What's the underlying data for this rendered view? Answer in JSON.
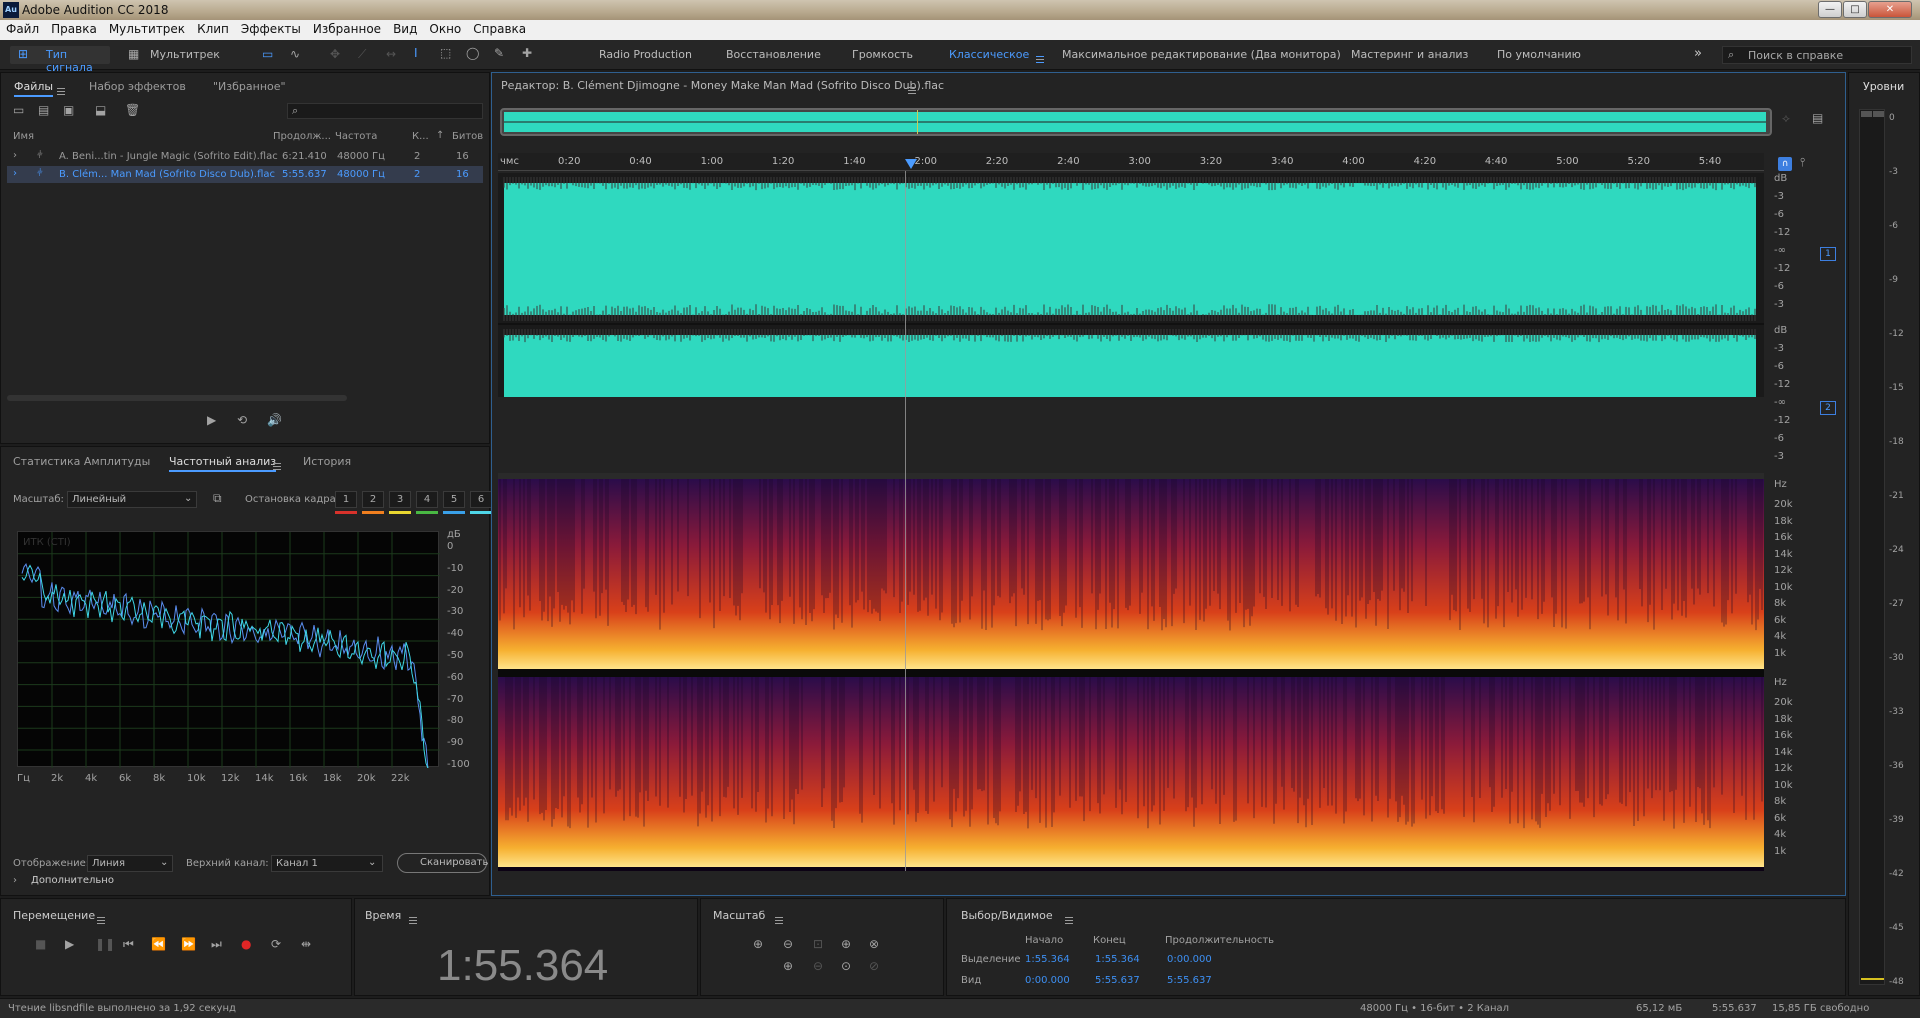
{
  "app": {
    "title": "Adobe Audition CC 2018",
    "logo_text": "Au"
  },
  "window_controls": [
    "—",
    "□",
    "✕"
  ],
  "menu": [
    "Файл",
    "Правка",
    "Мультитрек",
    "Клип",
    "Эффекты",
    "Избранное",
    "Вид",
    "Окно",
    "Справка"
  ],
  "toolbar": {
    "waveform_label": "Тип сигнала",
    "multitrack_label": "Мультитрек",
    "workspaces": [
      "Radio Production",
      "Восстановление",
      "Громкость",
      "Классическое",
      "Максимальное редактирование (Два монитора)",
      "Мастеринг и анализ",
      "По умолчанию"
    ],
    "active_workspace": "Классическое",
    "search_placeholder": "Поиск в справке"
  },
  "files_panel": {
    "tabs": [
      "Файлы",
      "Набор эффектов",
      "\"Избранное\""
    ],
    "columns": [
      "Имя",
      "Продолж...",
      "Частота",
      "К...",
      "Битов"
    ],
    "rows": [
      {
        "name": "A. Beni...tin - Jungle Magic (Sofrito Edit).flac",
        "duration": "6:21.410",
        "rate": "48000 Гц",
        "channels": "2",
        "bits": "16",
        "selected": false
      },
      {
        "name": "B. Clém... Man Mad (Sofrito Disco Dub).flac",
        "duration": "5:55.637",
        "rate": "48000 Гц",
        "channels": "2",
        "bits": "16",
        "selected": true
      }
    ]
  },
  "analysis_panel": {
    "tabs": [
      "Статистика Амплитуды",
      "Частотный анализ",
      "История"
    ],
    "scale_label": "Масштаб:",
    "scale_value": "Линейный",
    "freeze_label": "Остановка кадра:",
    "freeze_buttons": [
      "1",
      "2",
      "3",
      "4",
      "5",
      "6"
    ],
    "freeze_colors": [
      "#d8322b",
      "#f07f1f",
      "#e8d630",
      "#49b843",
      "#3aa0e8",
      "#4fd6e8"
    ],
    "graph_label": "ИТК (СТІ)",
    "db_unit": "дБ",
    "db_ticks": [
      "0",
      "-10",
      "-20",
      "-30",
      "-40",
      "-50",
      "-60",
      "-70",
      "-80",
      "-90",
      "-100"
    ],
    "freq_ticks": [
      "Гц",
      "2k",
      "4k",
      "6k",
      "8k",
      "10k",
      "12k",
      "14k",
      "16k",
      "18k",
      "20k",
      "22k"
    ],
    "display_label": "Отображение:",
    "display_value": "Линия",
    "channel_label": "Верхний канал:",
    "channel_value": "Канал 1",
    "scan_label": "Сканировать",
    "advanced_label": "Дополнительно"
  },
  "editor": {
    "title": "Редактор: B. Clément Djimogne - Money Make Man Mad (Sofrito Disco Dub).flac",
    "time_ruler": [
      "чмс",
      "0:20",
      "0:40",
      "1:00",
      "1:20",
      "1:40",
      "2:00",
      "2:20",
      "2:40",
      "3:00",
      "3:20",
      "3:40",
      "4:00",
      "4:20",
      "4:40",
      "5:00",
      "5:20",
      "5:40"
    ],
    "db_scale": [
      "dB",
      "-3",
      "-6",
      "-12",
      "-∞",
      "-12",
      "-6",
      "-3"
    ],
    "channel_badges": [
      "1",
      "2"
    ],
    "hz_scale": [
      "Hz",
      "20k",
      "18k",
      "16k",
      "14k",
      "12k",
      "10k",
      "8k",
      "6k",
      "4k",
      "1k"
    ],
    "wave_color": "#2fd9bf",
    "playhead_time": "1:55.364"
  },
  "levels_panel": {
    "title": "Уровни",
    "ticks": [
      "0",
      "-3",
      "-6",
      "-9",
      "-12",
      "-15",
      "-18",
      "-21",
      "-24",
      "-27",
      "-30",
      "-33",
      "-36",
      "-39",
      "-42",
      "-45",
      "-48"
    ]
  },
  "transport": {
    "title": "Перемещение"
  },
  "time_panel": {
    "title": "Время",
    "value": "1:55.364"
  },
  "zoom_panel": {
    "title": "Масштаб"
  },
  "selection_panel": {
    "title": "Выбор/Видимое",
    "col_start": "Начало",
    "col_end": "Конец",
    "col_duration": "Продолжительность",
    "row_selection": {
      "label": "Выделение",
      "start": "1:55.364",
      "end": "1:55.364",
      "duration": "0:00.000"
    },
    "row_view": {
      "label": "Вид",
      "start": "0:00.000",
      "end": "5:55.637",
      "duration": "5:55.637"
    }
  },
  "statusbar": {
    "message": "Чтение libsndfile выполнено за 1,92 секунд",
    "format": "48000 Гц • 16-бит • 2 Канал",
    "size": "65,12 мБ",
    "duration": "5:55.637",
    "free": "15,85 ГБ свободно"
  }
}
